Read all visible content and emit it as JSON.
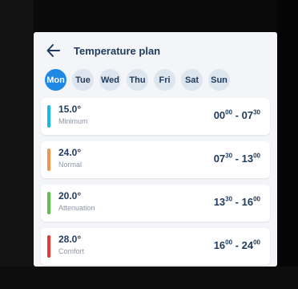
{
  "header": {
    "title": "Temperature plan",
    "back_icon": "arrow-left-icon"
  },
  "days": [
    "Mon",
    "Tue",
    "Wed",
    "Thu",
    "Fri",
    "Sat",
    "Sun"
  ],
  "selected_day": "Mon",
  "slots": [
    {
      "temp": "15.0°",
      "mode": "Minimum",
      "color": "#1bb6e6",
      "start_h": "00",
      "start_m": "00",
      "sep": " - ",
      "end_h": "07",
      "end_m": "30"
    },
    {
      "temp": "24.0°",
      "mode": "Normal",
      "color": "#f0954a",
      "start_h": "07",
      "start_m": "30",
      "sep": " - ",
      "end_h": "13",
      "end_m": "00"
    },
    {
      "temp": "20.0°",
      "mode": "Attenuation",
      "color": "#5cc14f",
      "start_h": "13",
      "start_m": "30",
      "sep": " - ",
      "end_h": "16",
      "end_m": "00"
    },
    {
      "temp": "28.0°",
      "mode": "Comfort",
      "color": "#e53935",
      "start_h": "16",
      "start_m": "00",
      "sep": " - ",
      "end_h": "24",
      "end_m": "00"
    }
  ],
  "colors": {
    "accent": "#1e88e5",
    "text": "#1f3a5c",
    "muted": "#8d98a5",
    "background": "#f3f5f8"
  }
}
